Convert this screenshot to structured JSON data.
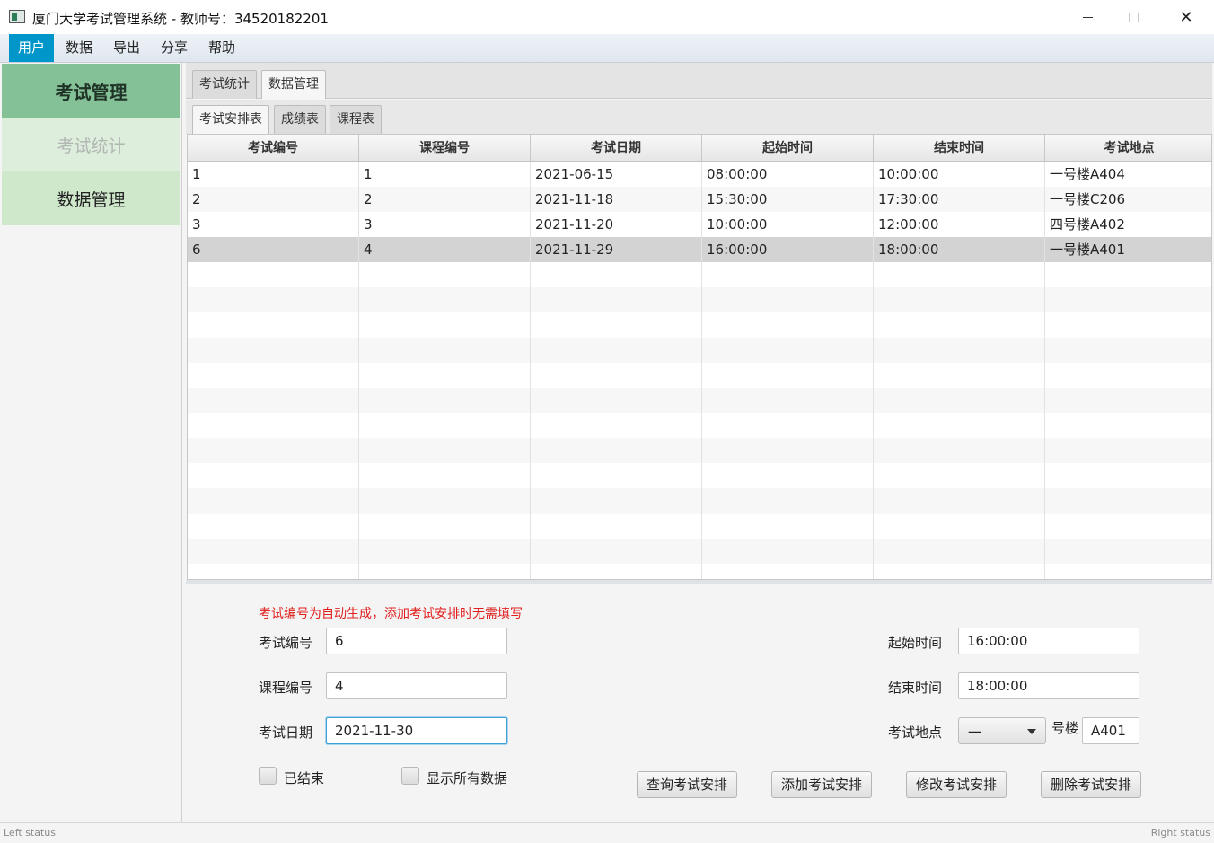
{
  "window": {
    "title": "厦门大学考试管理系统 - 教师号：34520182201",
    "minimize_icon": "minimize-icon",
    "maximize_icon": "maximize-icon",
    "close_icon": "close-icon",
    "close_glyph": "✕"
  },
  "menu": {
    "items": [
      {
        "label": "用户",
        "active": true
      },
      {
        "label": "数据",
        "active": false
      },
      {
        "label": "导出",
        "active": false
      },
      {
        "label": "分享",
        "active": false
      },
      {
        "label": "帮助",
        "active": false
      }
    ]
  },
  "sidebar": {
    "header": "考试管理",
    "items": [
      {
        "label": "考试统计"
      },
      {
        "label": "数据管理"
      }
    ]
  },
  "tabs": {
    "top": [
      {
        "label": "考试统计",
        "selected": false
      },
      {
        "label": "数据管理",
        "selected": true
      }
    ],
    "sub": [
      {
        "label": "考试安排表",
        "selected": true
      },
      {
        "label": "成绩表",
        "selected": false
      },
      {
        "label": "课程表",
        "selected": false
      }
    ]
  },
  "table": {
    "columns": [
      "考试编号",
      "课程编号",
      "考试日期",
      "起始时间",
      "结束时间",
      "考试地点"
    ],
    "rows": [
      [
        "1",
        "1",
        "2021-06-15",
        "08:00:00",
        "10:00:00",
        "一号楼A404"
      ],
      [
        "2",
        "2",
        "2021-11-18",
        "15:30:00",
        "17:30:00",
        "一号楼C206"
      ],
      [
        "3",
        "3",
        "2021-11-20",
        "10:00:00",
        "12:00:00",
        "四号楼A402"
      ],
      [
        "6",
        "4",
        "2021-11-29",
        "16:00:00",
        "18:00:00",
        "一号楼A401"
      ]
    ],
    "selected_row": 4
  },
  "form": {
    "hint": "考试编号为自动生成，添加考试安排时无需填写",
    "exam_id_label": "考试编号",
    "exam_id_value": "6",
    "course_id_label": "课程编号",
    "course_id_value": "4",
    "exam_date_label": "考试日期",
    "exam_date_value": "2021-11-30",
    "start_time_label": "起始时间",
    "start_time_value": "16:00:00",
    "end_time_label": "结束时间",
    "end_time_value": "18:00:00",
    "location_label": "考试地点",
    "building_value": "一",
    "building_suffix": "号楼",
    "room_value": "A401",
    "finished_label": "已结束",
    "show_all_label": "显示所有数据",
    "query_button": "查询考试安排",
    "add_button": "添加考试安排",
    "modify_button": "修改考试安排",
    "delete_button": "删除考试安排"
  },
  "status": {
    "left": "Left status",
    "right": "Right status"
  }
}
